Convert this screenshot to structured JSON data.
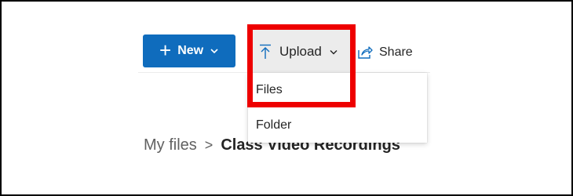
{
  "toolbar": {
    "new_label": "New",
    "new_icon": "plus-icon",
    "upload_label": "Upload",
    "upload_icon": "upload-arrow-icon",
    "share_label": "Share",
    "share_icon": "share-icon"
  },
  "upload_menu": {
    "items": [
      {
        "label": "Files"
      },
      {
        "label": "Folder"
      }
    ]
  },
  "breadcrumb": {
    "root": "My files",
    "separator": ">",
    "current": "Class Video Recordings"
  },
  "colors": {
    "accent": "#0f6cbd",
    "highlight": "#ee0000"
  }
}
